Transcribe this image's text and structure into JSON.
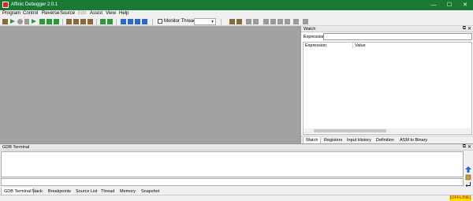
{
  "window": {
    "title": "Affinic Debugger 2.0.1",
    "minimize": "—",
    "maximize": "☐",
    "close": "✕"
  },
  "menu": [
    "Program",
    "Control",
    "Reverse",
    "Source",
    "Edit",
    "Assist",
    "View",
    "Help"
  ],
  "menu_disabled": [
    "Edit"
  ],
  "toolbar": {
    "monitor_threads_label": "Monitor Threads:",
    "monitor_threads_checked": false,
    "thread_combo_value": ""
  },
  "watch": {
    "title": "Watch",
    "expression_label": "Expression:",
    "expression_value": "",
    "columns": [
      "Expression",
      "Value"
    ],
    "tabs": [
      "Watch",
      "Registers",
      "Input History",
      "Definition",
      "ASM to Binary"
    ],
    "active_tab": "Watch"
  },
  "gdb_terminal": {
    "title": "GDB Terminal",
    "input_value": ""
  },
  "bottom_tabs": [
    "GDB Terminal",
    "Stack",
    "Breakpoints",
    "Source List",
    "Thread",
    "Memory",
    "Snapshot"
  ],
  "active_bottom_tab": "GDB Terminal",
  "status": {
    "connection": "[OFFLINE]"
  },
  "colors": {
    "titlebar": "#1a7a35",
    "offline_bg": "#ffe600",
    "offline_fg": "#bb0000"
  }
}
